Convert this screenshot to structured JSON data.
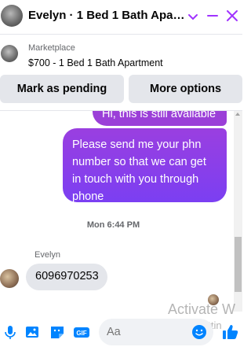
{
  "header": {
    "title": "Evelyn · 1 Bed 1 Bath Apart...",
    "accent_color": "#a033ff"
  },
  "marketplace": {
    "label": "Marketplace",
    "listing": "$700 - 1 Bed 1 Bath Apartment"
  },
  "actions": {
    "pending_label": "Mark as pending",
    "more_label": "More options"
  },
  "messages": {
    "previous_outgoing": "Hi, this is still available",
    "outgoing": "Please send me your phn number so that we can get in touch with you through phone",
    "timestamp": "Mon 6:44 PM",
    "sender": "Evelyn",
    "incoming": "6096970253"
  },
  "composer": {
    "placeholder": "Aa"
  },
  "watermark": {
    "line1": "Activate W",
    "line2": "Go to Settin"
  },
  "colors": {
    "bubble_out_top": "#9a3fe0",
    "bubble_out_bottom": "#7b3ff2",
    "bubble_in": "#e4e6eb",
    "composer_icons": "#0084ff"
  }
}
